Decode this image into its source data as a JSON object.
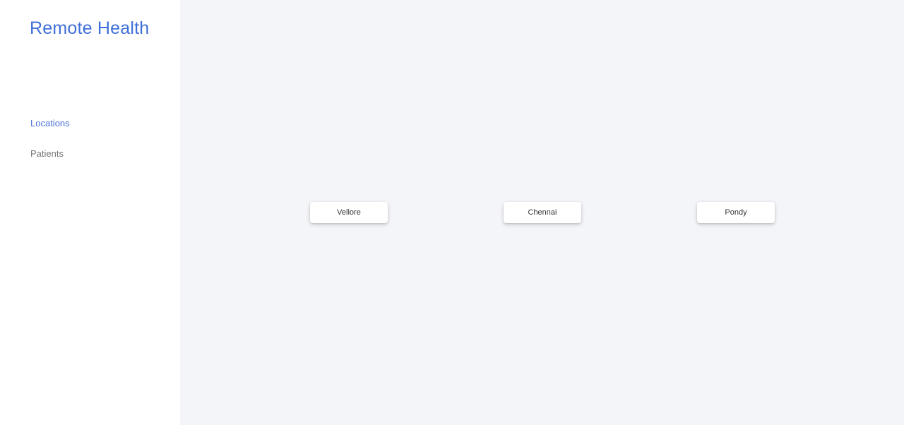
{
  "app": {
    "title": "Remote Health"
  },
  "sidebar": {
    "items": [
      {
        "label": "Locations",
        "active": true
      },
      {
        "label": "Patients",
        "active": false
      }
    ]
  },
  "main": {
    "locations": [
      {
        "label": "Vellore"
      },
      {
        "label": "Chennai"
      },
      {
        "label": "Pondy"
      }
    ]
  },
  "colors": {
    "accent": "#3f6fd8",
    "nav_inactive": "#757575",
    "background": "#f4f5f9",
    "sidebar_background": "#ffffff"
  }
}
